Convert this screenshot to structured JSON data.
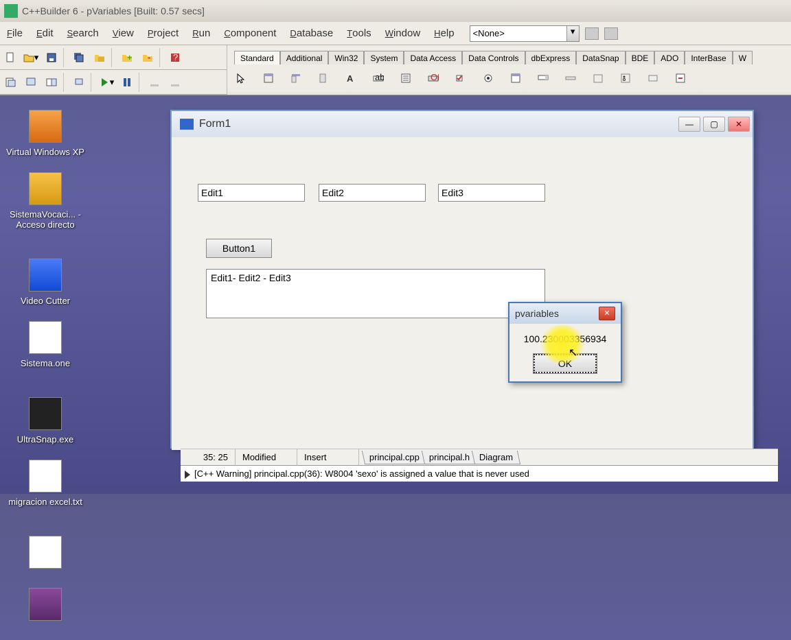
{
  "title": "C++Builder 6 - pVariables [Built: 0.57 secs]",
  "menu": [
    "File",
    "Edit",
    "Search",
    "View",
    "Project",
    "Run",
    "Component",
    "Database",
    "Tools",
    "Window",
    "Help"
  ],
  "combo_value": "<None>",
  "palette_tabs": [
    "Standard",
    "Additional",
    "Win32",
    "System",
    "Data Access",
    "Data Controls",
    "dbExpress",
    "DataSnap",
    "BDE",
    "ADO",
    "InterBase",
    "W"
  ],
  "desktop": [
    {
      "label": "Virtual Windows XP"
    },
    {
      "label": "SistemaVocaci... - Acceso directo"
    },
    {
      "label": "Video Cutter"
    },
    {
      "label": "Sistema.one"
    },
    {
      "label": "UltraSnap.exe"
    },
    {
      "label": "migracion excel.txt"
    }
  ],
  "form": {
    "title": "Form1",
    "edit1": "Edit1",
    "edit2": "Edit2",
    "edit3": "Edit3",
    "button1": "Button1",
    "memo": "Edit1- Edit2 - Edit3"
  },
  "dialog": {
    "title": "pvariables",
    "value": "100.230003356934",
    "ok": "OK"
  },
  "status": {
    "pos": "35: 25",
    "modified": "Modified",
    "mode": "Insert",
    "tabs": [
      "principal.cpp",
      "principal.h",
      "Diagram"
    ],
    "warning": "[C++ Warning] principal.cpp(36): W8004 'sexo' is assigned a value that is never used"
  }
}
